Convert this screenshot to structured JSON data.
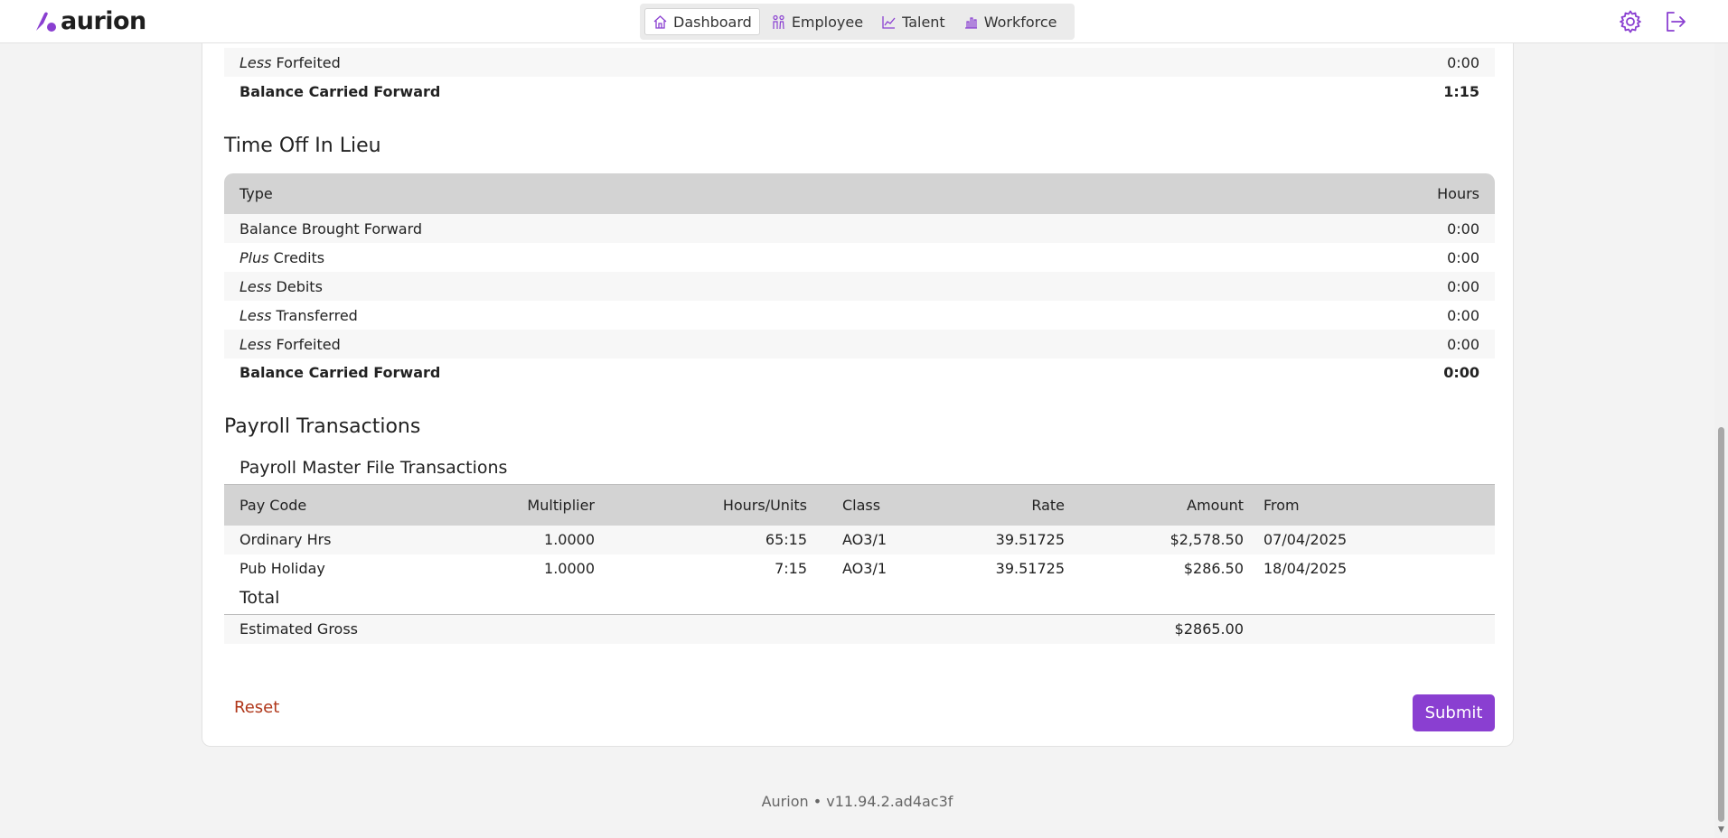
{
  "header": {
    "logo_text": "aurion",
    "nav_tabs": [
      {
        "label": "Dashboard",
        "icon": "home-icon"
      },
      {
        "label": "Employee",
        "icon": "people-icon"
      },
      {
        "label": "Talent",
        "icon": "line-chart-icon"
      },
      {
        "label": "Workforce",
        "icon": "bar-chart-icon"
      }
    ],
    "brand_color": "#8a3fd1"
  },
  "leave_tail": {
    "rows": [
      {
        "prefix": "Less",
        "label": "Forfeited",
        "value": "0:00"
      },
      {
        "prefix": "",
        "label": "Balance Carried Forward",
        "value": "1:15"
      }
    ]
  },
  "toil": {
    "title": "Time Off In Lieu",
    "col_type": "Type",
    "col_hours": "Hours",
    "rows": [
      {
        "prefix": "",
        "label": "Balance Brought Forward",
        "value": "0:00"
      },
      {
        "prefix": "Plus",
        "label": "Credits",
        "value": "0:00"
      },
      {
        "prefix": "Less",
        "label": "Debits",
        "value": "0:00"
      },
      {
        "prefix": "Less",
        "label": "Transferred",
        "value": "0:00"
      },
      {
        "prefix": "Less",
        "label": "Forfeited",
        "value": "0:00"
      },
      {
        "prefix": "",
        "label": "Balance Carried Forward",
        "value": "0:00"
      }
    ]
  },
  "payroll": {
    "title": "Payroll Transactions",
    "subtitle": "Payroll Master File Transactions",
    "columns": [
      "Pay Code",
      "Multiplier",
      "Hours/Units",
      "Class",
      "Rate",
      "Amount",
      "From"
    ],
    "rows": [
      [
        "Ordinary Hrs",
        "1.0000",
        "65:15",
        "AO3/1",
        "39.51725",
        "$2,578.50",
        "07/04/2025"
      ],
      [
        "Pub Holiday",
        "1.0000",
        "7:15",
        "AO3/1",
        "39.51725",
        "$286.50",
        "18/04/2025"
      ]
    ],
    "total_title": "Total",
    "total_label": "Estimated Gross",
    "total_amount": "$2865.00"
  },
  "actions": {
    "reset_label": "Reset",
    "submit_label": "Submit"
  },
  "footer": {
    "text": "Aurion • v11.94.2.ad4ac3f"
  }
}
